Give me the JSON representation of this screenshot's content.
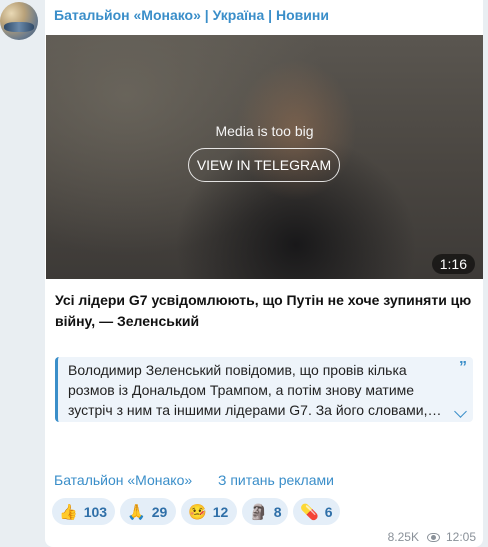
{
  "channel": {
    "title": "Батальйон «Монако» | Україна | Новини"
  },
  "media": {
    "note": "Media is too big",
    "button_label": "VIEW IN TELEGRAM",
    "duration": "1:16"
  },
  "post": {
    "headline": "Усі лідери G7 усвідомлюють, що Путін не хоче зупиняти цю війну, — Зеленський",
    "quote": "Володимир Зеленський повідомив, що провів кілька розмов із Дональдом Трампом, а потім знову матиме зустріч з ним та іншими лідерами G7. За його словами,…"
  },
  "links": {
    "channel": "Батальйон «Монако»",
    "ads": "З питань реклами"
  },
  "reactions": [
    {
      "emoji": "👍",
      "icon": "thumbs-up-icon",
      "count": "103"
    },
    {
      "emoji": "🙏",
      "icon": "praying-hands-icon",
      "count": "29"
    },
    {
      "emoji": "🤒",
      "icon": "sick-face-icon",
      "count": "12"
    },
    {
      "emoji": "🗿",
      "icon": "moai-icon",
      "count": "8"
    },
    {
      "emoji": "💊",
      "icon": "pill-icon",
      "count": "6"
    }
  ],
  "meta": {
    "views": "8.25K",
    "time": "12:05"
  },
  "colors": {
    "accent": "#3a8ec9",
    "bubble": "#ffffff",
    "background": "#e9eef2"
  }
}
